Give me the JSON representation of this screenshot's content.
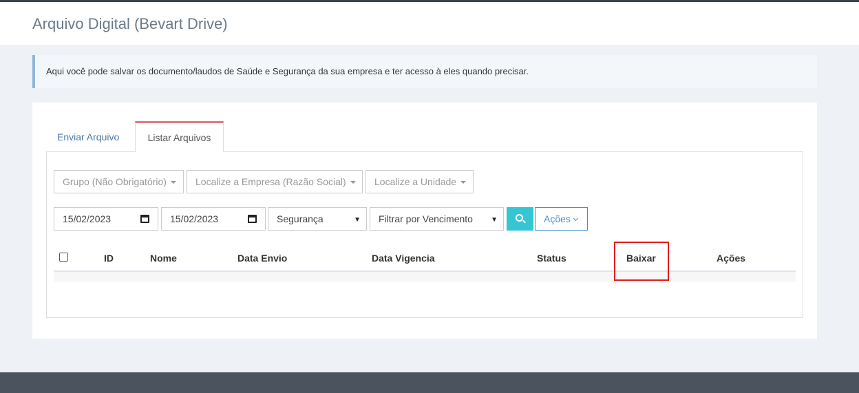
{
  "header": {
    "title": "Arquivo Digital (Bevart Drive)"
  },
  "info_note": "Aqui você pode salvar os documento/laudos de Saúde e Segurança da sua empresa e ter acesso à eles quando precisar.",
  "tabs": [
    {
      "label": "Enviar Arquivo",
      "active": false
    },
    {
      "label": "Listar Arquivos",
      "active": true
    }
  ],
  "filters": {
    "group_dropdown": "Grupo (Não Obrigatório)",
    "company_dropdown": "Localize a Empresa (Razão Social)",
    "unit_dropdown": "Localize a Unidade",
    "date_start": "15/02/2023",
    "date_end": "15/02/2023",
    "category_select": "Segurança",
    "filter_select": "Filtrar por Vencimento",
    "search_icon": "search-icon",
    "actions_button": "Ações"
  },
  "table": {
    "columns": [
      "ID",
      "Nome",
      "Data Envio",
      "Data Vigencia",
      "Status",
      "Baixar",
      "Ações"
    ],
    "rows": []
  },
  "colors": {
    "accent_tab": "#e3797e",
    "search_button": "#36c6d3",
    "actions_button": "#4c8dd6",
    "highlight_box": "#e31b1b"
  }
}
